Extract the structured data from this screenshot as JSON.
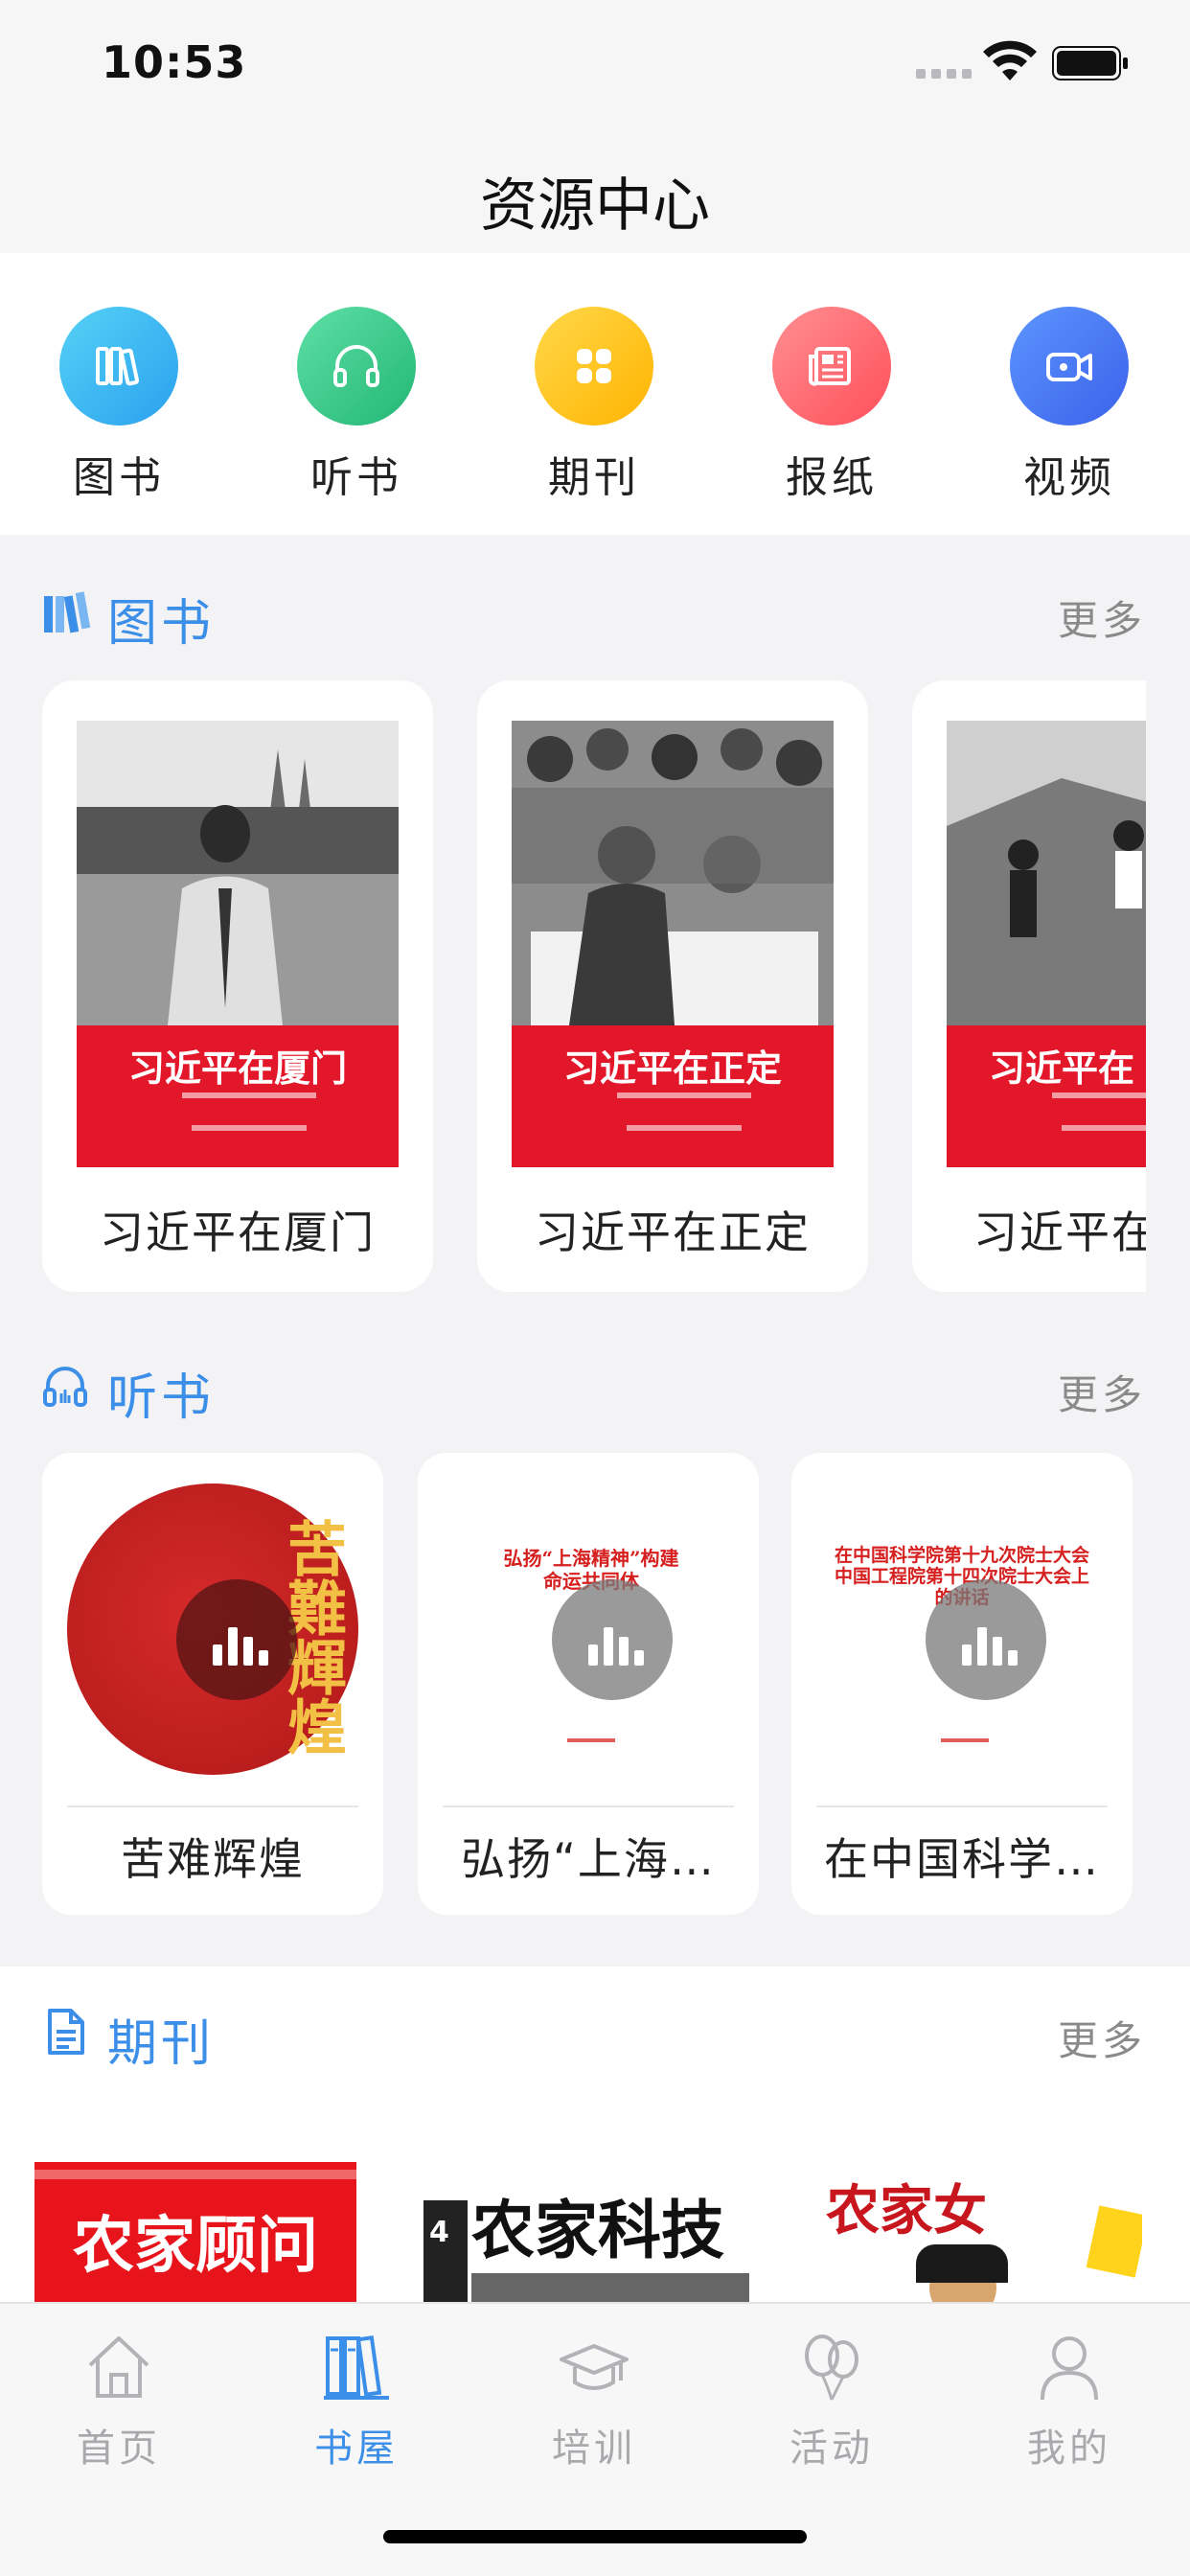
{
  "status": {
    "time": "10:53"
  },
  "header": {
    "title": "资源中心"
  },
  "categories": [
    {
      "label": "图书",
      "icon": "books-icon",
      "color": "#3ab4f2"
    },
    {
      "label": "听书",
      "icon": "headphones-icon",
      "color": "#34c98a"
    },
    {
      "label": "期刊",
      "icon": "clover-icon",
      "color": "#ffc21f"
    },
    {
      "label": "报纸",
      "icon": "newspaper-icon",
      "color": "#ff6b73"
    },
    {
      "label": "视频",
      "icon": "video-camera-icon",
      "color": "#4d7ef6"
    }
  ],
  "books": {
    "title": "图书",
    "more": "更多",
    "items": [
      {
        "name": "习近平在厦门",
        "cover_title": "习近平在厦门"
      },
      {
        "name": "习近平在正定",
        "cover_title": "习近平在正定"
      },
      {
        "name": "习近平在",
        "cover_title": "习近平在"
      }
    ]
  },
  "audio": {
    "title": "听书",
    "more": "更多",
    "items": [
      {
        "name": "苦难辉煌",
        "cover_text": "苦難輝煌"
      },
      {
        "name": "弘扬“上海…",
        "cover_text": "弘扬“上海精神”构建命运共同体"
      },
      {
        "name": "在中国科学…",
        "cover_text": "在中国科学院第十九次院士大会中国工程院第十四次院士大会上的讲话"
      }
    ]
  },
  "periodicals": {
    "title": "期刊",
    "more": "更多",
    "items": [
      {
        "cover_text": "农家顾问"
      },
      {
        "cover_text": "农家科技"
      },
      {
        "cover_text": "农家女"
      }
    ]
  },
  "tabbar": {
    "items": [
      {
        "label": "首页",
        "icon": "home-icon"
      },
      {
        "label": "书屋",
        "icon": "bookshelf-icon",
        "active": true
      },
      {
        "label": "培训",
        "icon": "graduation-cap-icon"
      },
      {
        "label": "活动",
        "icon": "balloons-icon"
      },
      {
        "label": "我的",
        "icon": "person-icon"
      }
    ]
  },
  "colors": {
    "accent": "#3c8fe8",
    "inactive": "#a9a9ad",
    "cover_red": "#e3172a"
  }
}
